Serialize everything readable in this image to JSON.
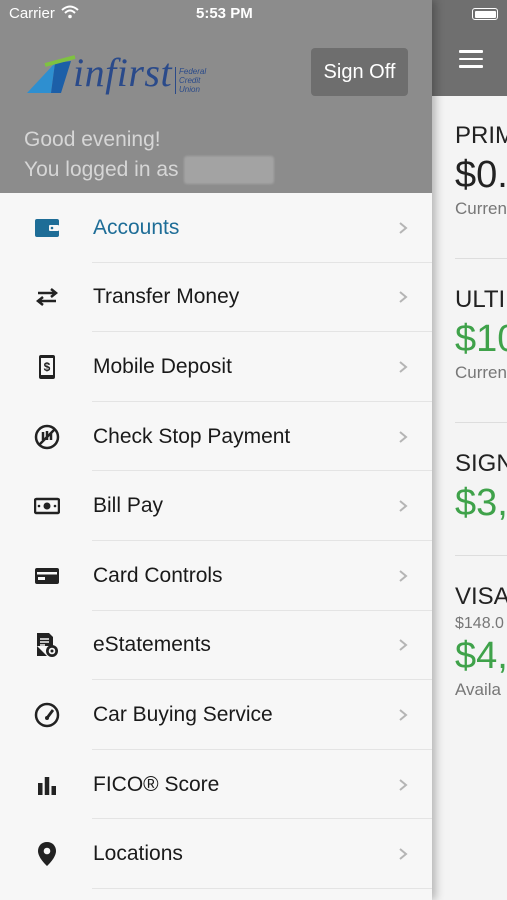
{
  "status_bar": {
    "carrier": "Carrier",
    "time": "5:53 PM"
  },
  "header": {
    "logo_text": "infirst",
    "logo_tagline": [
      "Federal",
      "Credit",
      "Union"
    ],
    "sign_off_label": "Sign Off",
    "greeting_line1": "Good evening!",
    "greeting_line2": "You logged in as"
  },
  "menu": {
    "items": [
      {
        "label": "Accounts",
        "icon": "wallet-icon",
        "active": true
      },
      {
        "label": "Transfer Money",
        "icon": "transfer-arrows-icon"
      },
      {
        "label": "Mobile Deposit",
        "icon": "mobile-deposit-icon"
      },
      {
        "label": "Check Stop Payment",
        "icon": "stop-payment-icon"
      },
      {
        "label": "Bill Pay",
        "icon": "bill-cash-icon"
      },
      {
        "label": "Card Controls",
        "icon": "credit-card-icon"
      },
      {
        "label": "eStatements",
        "icon": "statement-icon"
      },
      {
        "label": "Car Buying Service",
        "icon": "speedometer-icon"
      },
      {
        "label": "FICO® Score",
        "icon": "bar-chart-icon"
      },
      {
        "label": "Locations",
        "icon": "location-pin-icon"
      }
    ]
  },
  "background_accounts": [
    {
      "name": "PRIM",
      "amount": "$0.",
      "sub": "Curren",
      "green": false
    },
    {
      "name": "ULTI",
      "amount": "$10",
      "sub": "Curren",
      "green": true
    },
    {
      "name": "SIGN",
      "amount": "$3,",
      "sub": "",
      "green": true
    },
    {
      "name": "VISA",
      "pre": "$148.0",
      "amount": "$4,",
      "sub": "Availa",
      "green": true
    }
  ],
  "colors": {
    "active": "#1e6d97",
    "green": "#3fa24a",
    "header_bg": "#8c8c8c"
  }
}
